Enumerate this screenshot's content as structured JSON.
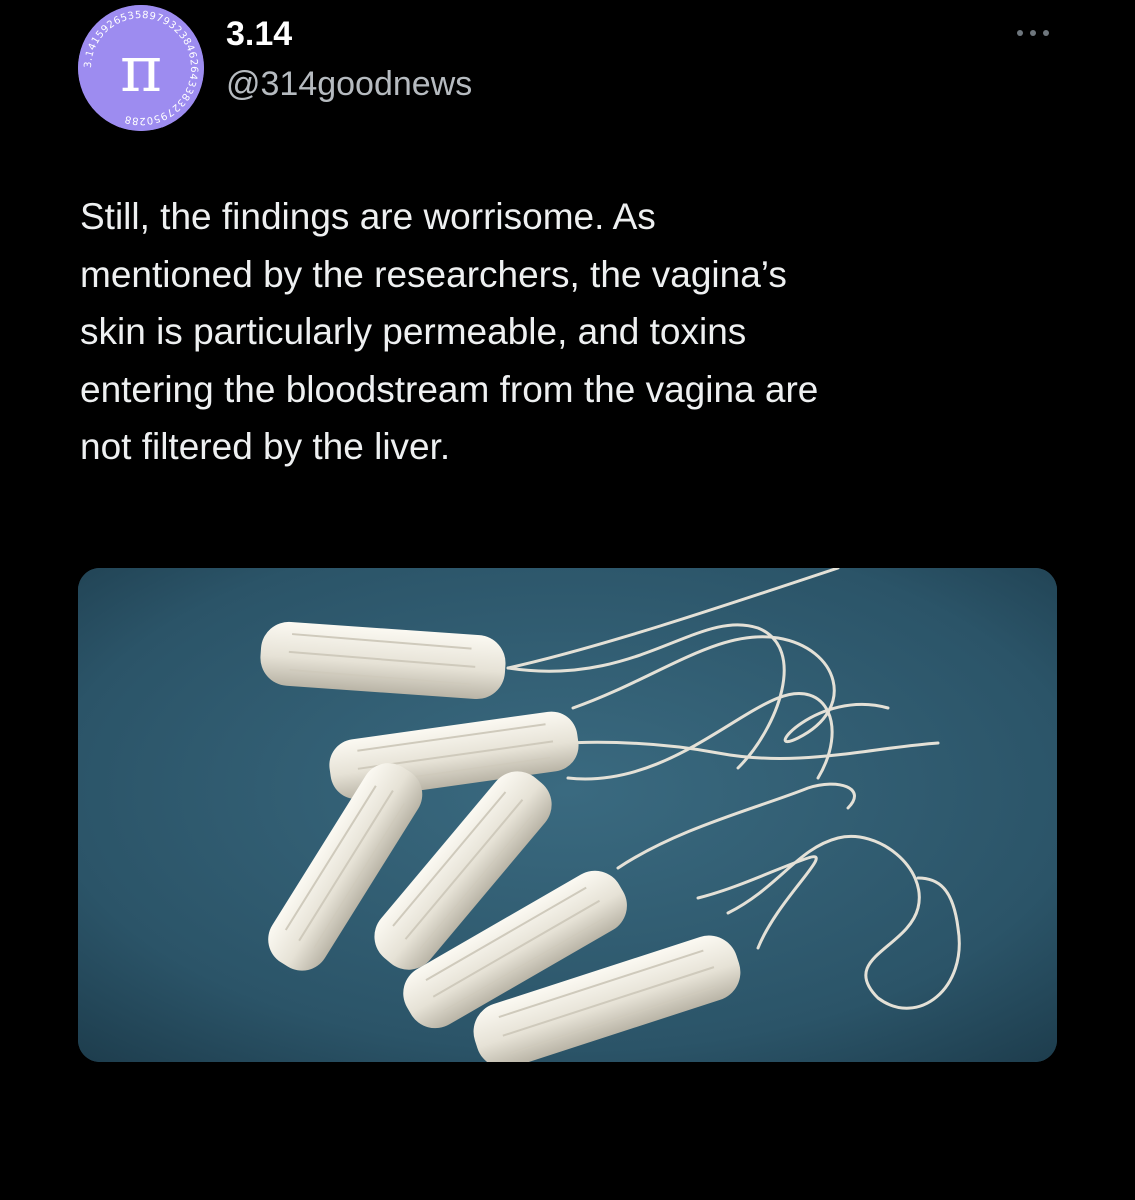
{
  "author": {
    "display_name": "3.14",
    "handle": "@314goodnews",
    "avatar_icon": "pi-symbol-icon",
    "avatar_color": "#9d8cf0",
    "avatar_digits": "3.14159265358979323846264338327950288"
  },
  "tweet": {
    "text": "Still, the findings are worrisome. As\nmentioned by the researchers, the vagina’s\nskin is particularly permeable, and toxins\nentering the bloodstream from the vagina are\nnot filtered by the liver."
  },
  "more_menu": {
    "icon": "more-dots-icon"
  },
  "media": {
    "background_color": "#2f5a6e",
    "item_color": "#e9e6dc"
  }
}
